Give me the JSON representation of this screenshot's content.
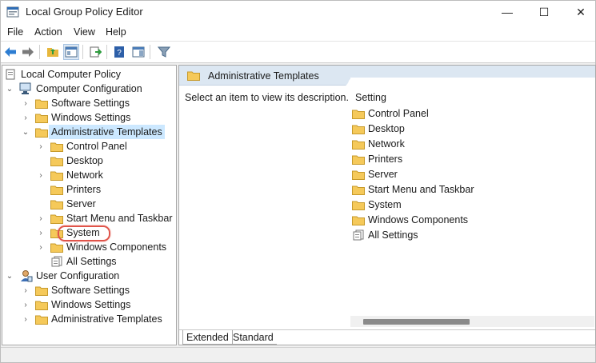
{
  "window": {
    "title": "Local Group Policy Editor"
  },
  "window_controls": {
    "minimize": "—",
    "maximize": "☐",
    "close": "✕"
  },
  "menu": [
    "File",
    "Action",
    "View",
    "Help"
  ],
  "tree": {
    "root": "Local Computer Policy",
    "computer_configuration": "Computer Configuration",
    "cc_software_settings": "Software Settings",
    "cc_windows_settings": "Windows Settings",
    "cc_admin_templates": "Administrative Templates",
    "at_control_panel": "Control Panel",
    "at_desktop": "Desktop",
    "at_network": "Network",
    "at_printers": "Printers",
    "at_server": "Server",
    "at_start_menu": "Start Menu and Taskbar",
    "at_system": "System",
    "at_windows_components": "Windows Components",
    "at_all_settings": "All Settings",
    "user_configuration": "User Configuration",
    "uc_software_settings": "Software Settings",
    "uc_windows_settings": "Windows Settings",
    "uc_admin_templates": "Administrative Templates"
  },
  "details": {
    "header_title": "Administrative Templates",
    "description": "Select an item to view its description.",
    "column_header": "Setting",
    "items": [
      "Control Panel",
      "Desktop",
      "Network",
      "Printers",
      "Server",
      "Start Menu and Taskbar",
      "System",
      "Windows Components",
      "All Settings"
    ]
  },
  "tabs": {
    "extended": "Extended",
    "standard": "Standard"
  },
  "colors": {
    "selection": "#cce8ff",
    "highlight_ring": "#e0544a",
    "folder": "#f5c95a",
    "header_band": "#dce7f2"
  }
}
